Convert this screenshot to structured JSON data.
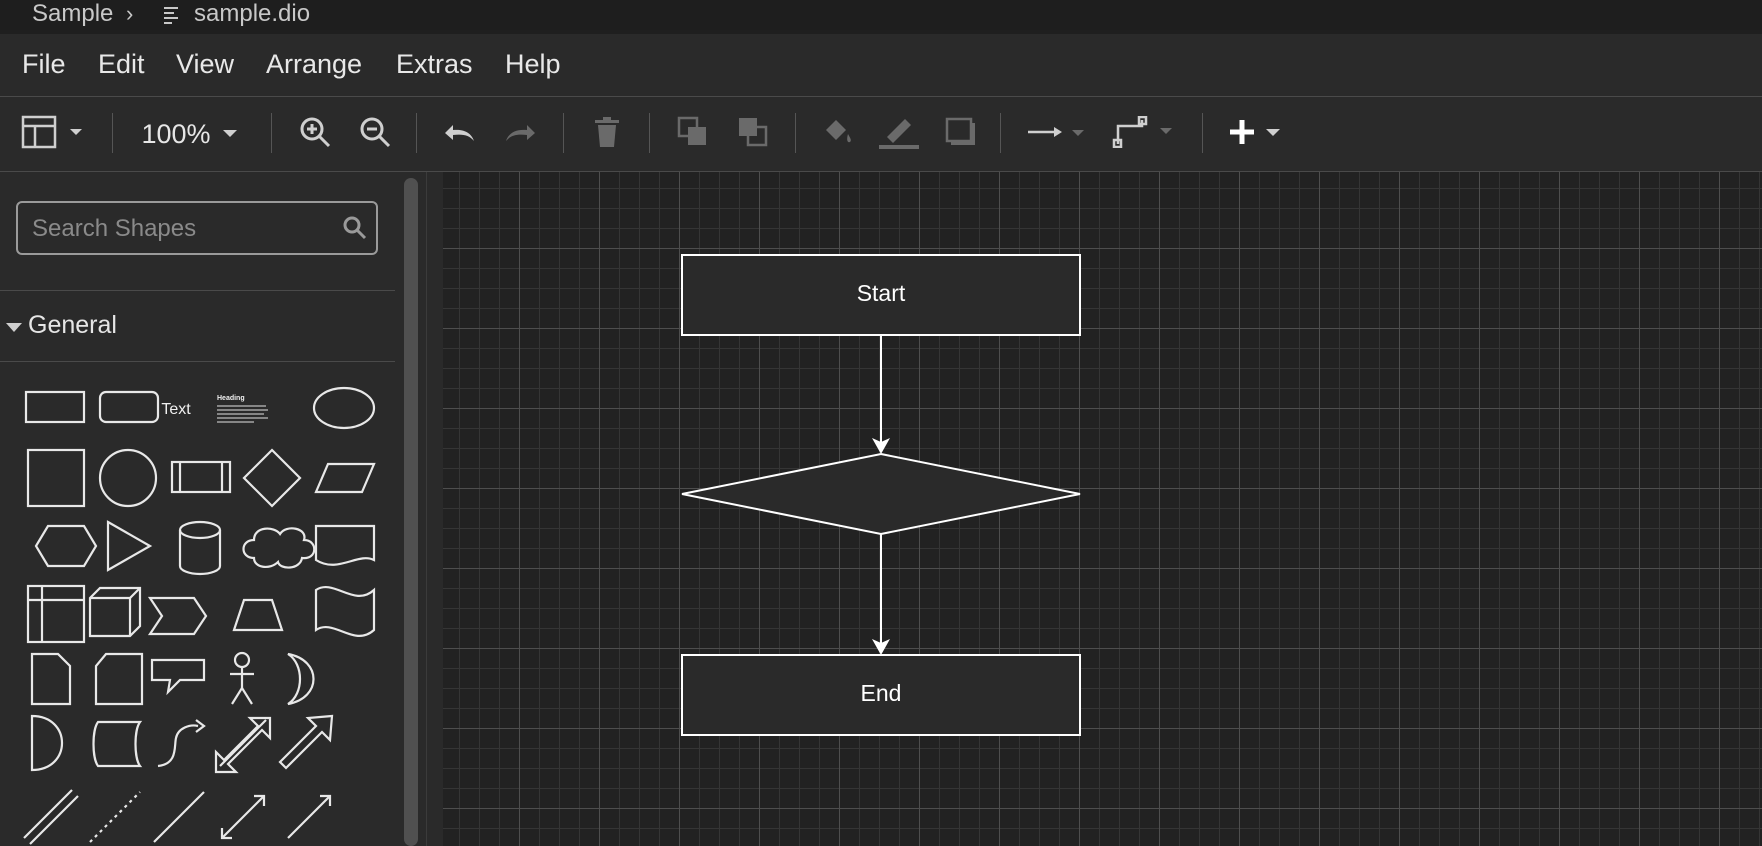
{
  "breadcrumb": {
    "folder": "Sample",
    "separator": "›",
    "file": "sample.dio",
    "file_icon": "file-lines-icon"
  },
  "menu": [
    "File",
    "Edit",
    "View",
    "Arrange",
    "Extras",
    "Help"
  ],
  "toolbar": {
    "zoom": "100%",
    "icons": [
      "layout-panel-icon",
      "zoom-in-icon",
      "zoom-out-icon",
      "undo-icon",
      "redo-icon",
      "delete-icon",
      "to-front-icon",
      "to-back-icon",
      "fill-color-icon",
      "line-color-icon",
      "shadow-icon",
      "connection-arrow-icon",
      "waypoints-icon",
      "insert-plus-icon"
    ]
  },
  "sidebar": {
    "search_placeholder": "Search Shapes",
    "section": "General",
    "text_shape_label": "Text",
    "heading_shape_label": "Heading"
  },
  "diagram": {
    "start_label": "Start",
    "end_label": "End"
  },
  "colors": {
    "background": "#1f1f1f",
    "panel": "#2a2a2a",
    "canvas": "#222222",
    "stroke": "#ffffff"
  }
}
